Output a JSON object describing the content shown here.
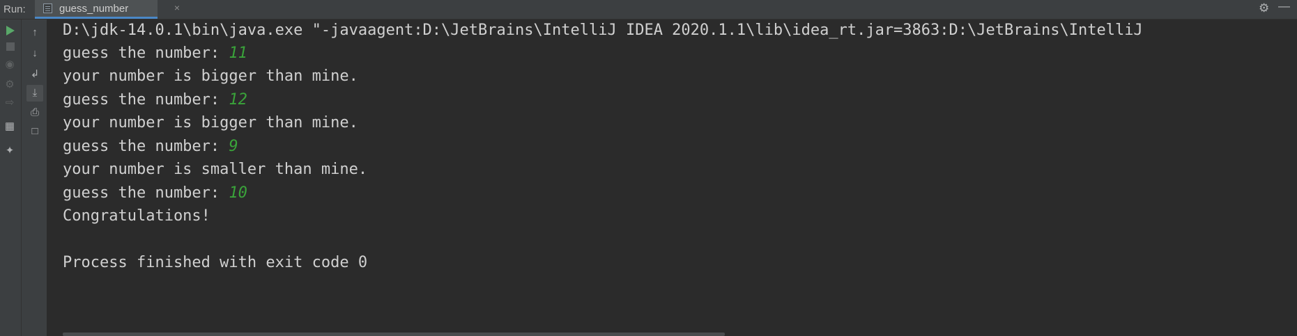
{
  "topbar": {
    "run_label": "Run:",
    "tab_label": "guess_number",
    "tab_close": "×"
  },
  "icons": {
    "settings": "gear-icon",
    "minimize": "minimize-icon"
  },
  "console": {
    "command": "D:\\jdk-14.0.1\\bin\\java.exe \"-javaagent:D:\\JetBrains\\IntelliJ IDEA 2020.1.1\\lib\\idea_rt.jar=3863:D:\\JetBrains\\IntelliJ",
    "lines": [
      {
        "prompt": "guess the number: ",
        "input": "11"
      },
      {
        "output": "your number is bigger than mine."
      },
      {
        "prompt": "guess the number: ",
        "input": "12"
      },
      {
        "output": "your number is bigger than mine."
      },
      {
        "prompt": "guess the number: ",
        "input": "9"
      },
      {
        "output": "your number is smaller than mine."
      },
      {
        "prompt": "guess the number: ",
        "input": "10"
      },
      {
        "output": "Congratulations!"
      }
    ],
    "exit_message": "Process finished with exit code 0"
  },
  "colors": {
    "background": "#2b2b2b",
    "text": "#d0d0d0",
    "user_input": "#3aa33a",
    "run_green": "#59a869",
    "tab_underline": "#4a88c7"
  }
}
